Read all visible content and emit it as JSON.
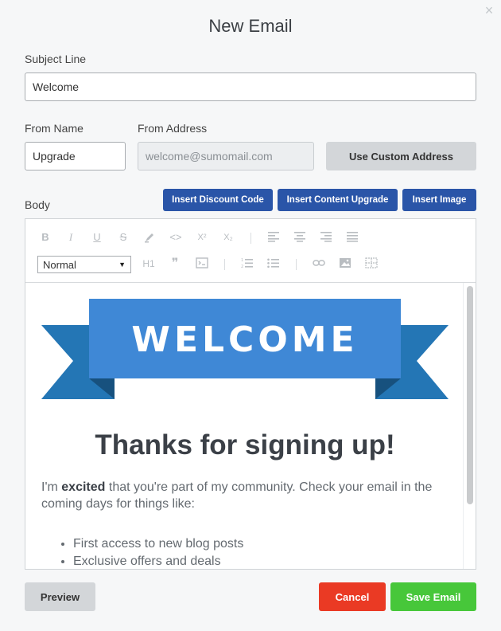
{
  "dialog": {
    "title": "New Email",
    "close_glyph": "×"
  },
  "subject": {
    "label": "Subject Line",
    "value": "Welcome"
  },
  "from_name": {
    "label": "From Name",
    "value": "Upgrade"
  },
  "from_address": {
    "label": "From Address",
    "placeholder": "welcome@sumomail.com",
    "custom_button": "Use Custom Address"
  },
  "body": {
    "label": "Body",
    "insert_buttons": {
      "discount": "Insert Discount Code",
      "content_upgrade": "Insert Content Upgrade",
      "image": "Insert Image"
    }
  },
  "toolbar": {
    "bold": "B",
    "italic": "I",
    "underline": "U",
    "strike": "S",
    "code_inline": "<>",
    "superscript": "X²",
    "subscript": "X₂",
    "format_select": "Normal",
    "h1": "H1",
    "quote": "❞",
    "icons": [
      "bold-icon",
      "italic-icon",
      "underline-icon",
      "strike-icon",
      "highlight-icon",
      "code-icon",
      "superscript-icon",
      "subscript-icon",
      "align-left-icon",
      "align-center-icon",
      "align-right-icon",
      "align-justify-icon",
      "h1-icon",
      "quote-icon",
      "code-block-icon",
      "ordered-list-icon",
      "bullet-list-icon",
      "link-icon",
      "image-icon",
      "table-icon"
    ]
  },
  "email": {
    "banner_text": "WELCOME",
    "heading": "Thanks for signing up!",
    "para_intro": "I'm ",
    "para_bold": "excited",
    "para_rest": " that you're part of my community. Check your email in the coming days for things like:",
    "list": [
      "First access to new blog posts",
      "Exclusive offers and deals"
    ]
  },
  "colors": {
    "banner_main": "#3f88d6",
    "banner_tail": "#2476b5",
    "banner_fold": "#17517e",
    "primary_blue": "#2a55a8",
    "cancel_red": "#ea3a24",
    "save_green": "#47c73a"
  },
  "footer": {
    "preview": "Preview",
    "cancel": "Cancel",
    "save": "Save Email"
  }
}
